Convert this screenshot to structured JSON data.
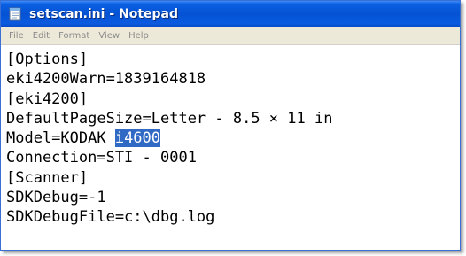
{
  "window": {
    "title": "setscan.ini - Notepad"
  },
  "menu": {
    "items": [
      "File",
      "Edit",
      "Format",
      "View",
      "Help"
    ]
  },
  "editor": {
    "lines": [
      "[Options]",
      "eki4200Warn=1839164818",
      "[eki4200]",
      "DefaultPageSize=Letter - 8.5 × 11 in",
      "Model=KODAK ",
      "Connection=STI - 0001",
      "[Scanner]",
      "SDKDebug=-1",
      "SDKDebugFile=c:\\dbg.log"
    ],
    "selected_text": "i4600"
  },
  "colors": {
    "titlebar": "#0553d4",
    "menubar": "#ece9d8",
    "selection": "#316ac5"
  },
  "icons": {
    "app": "notepad-icon"
  }
}
